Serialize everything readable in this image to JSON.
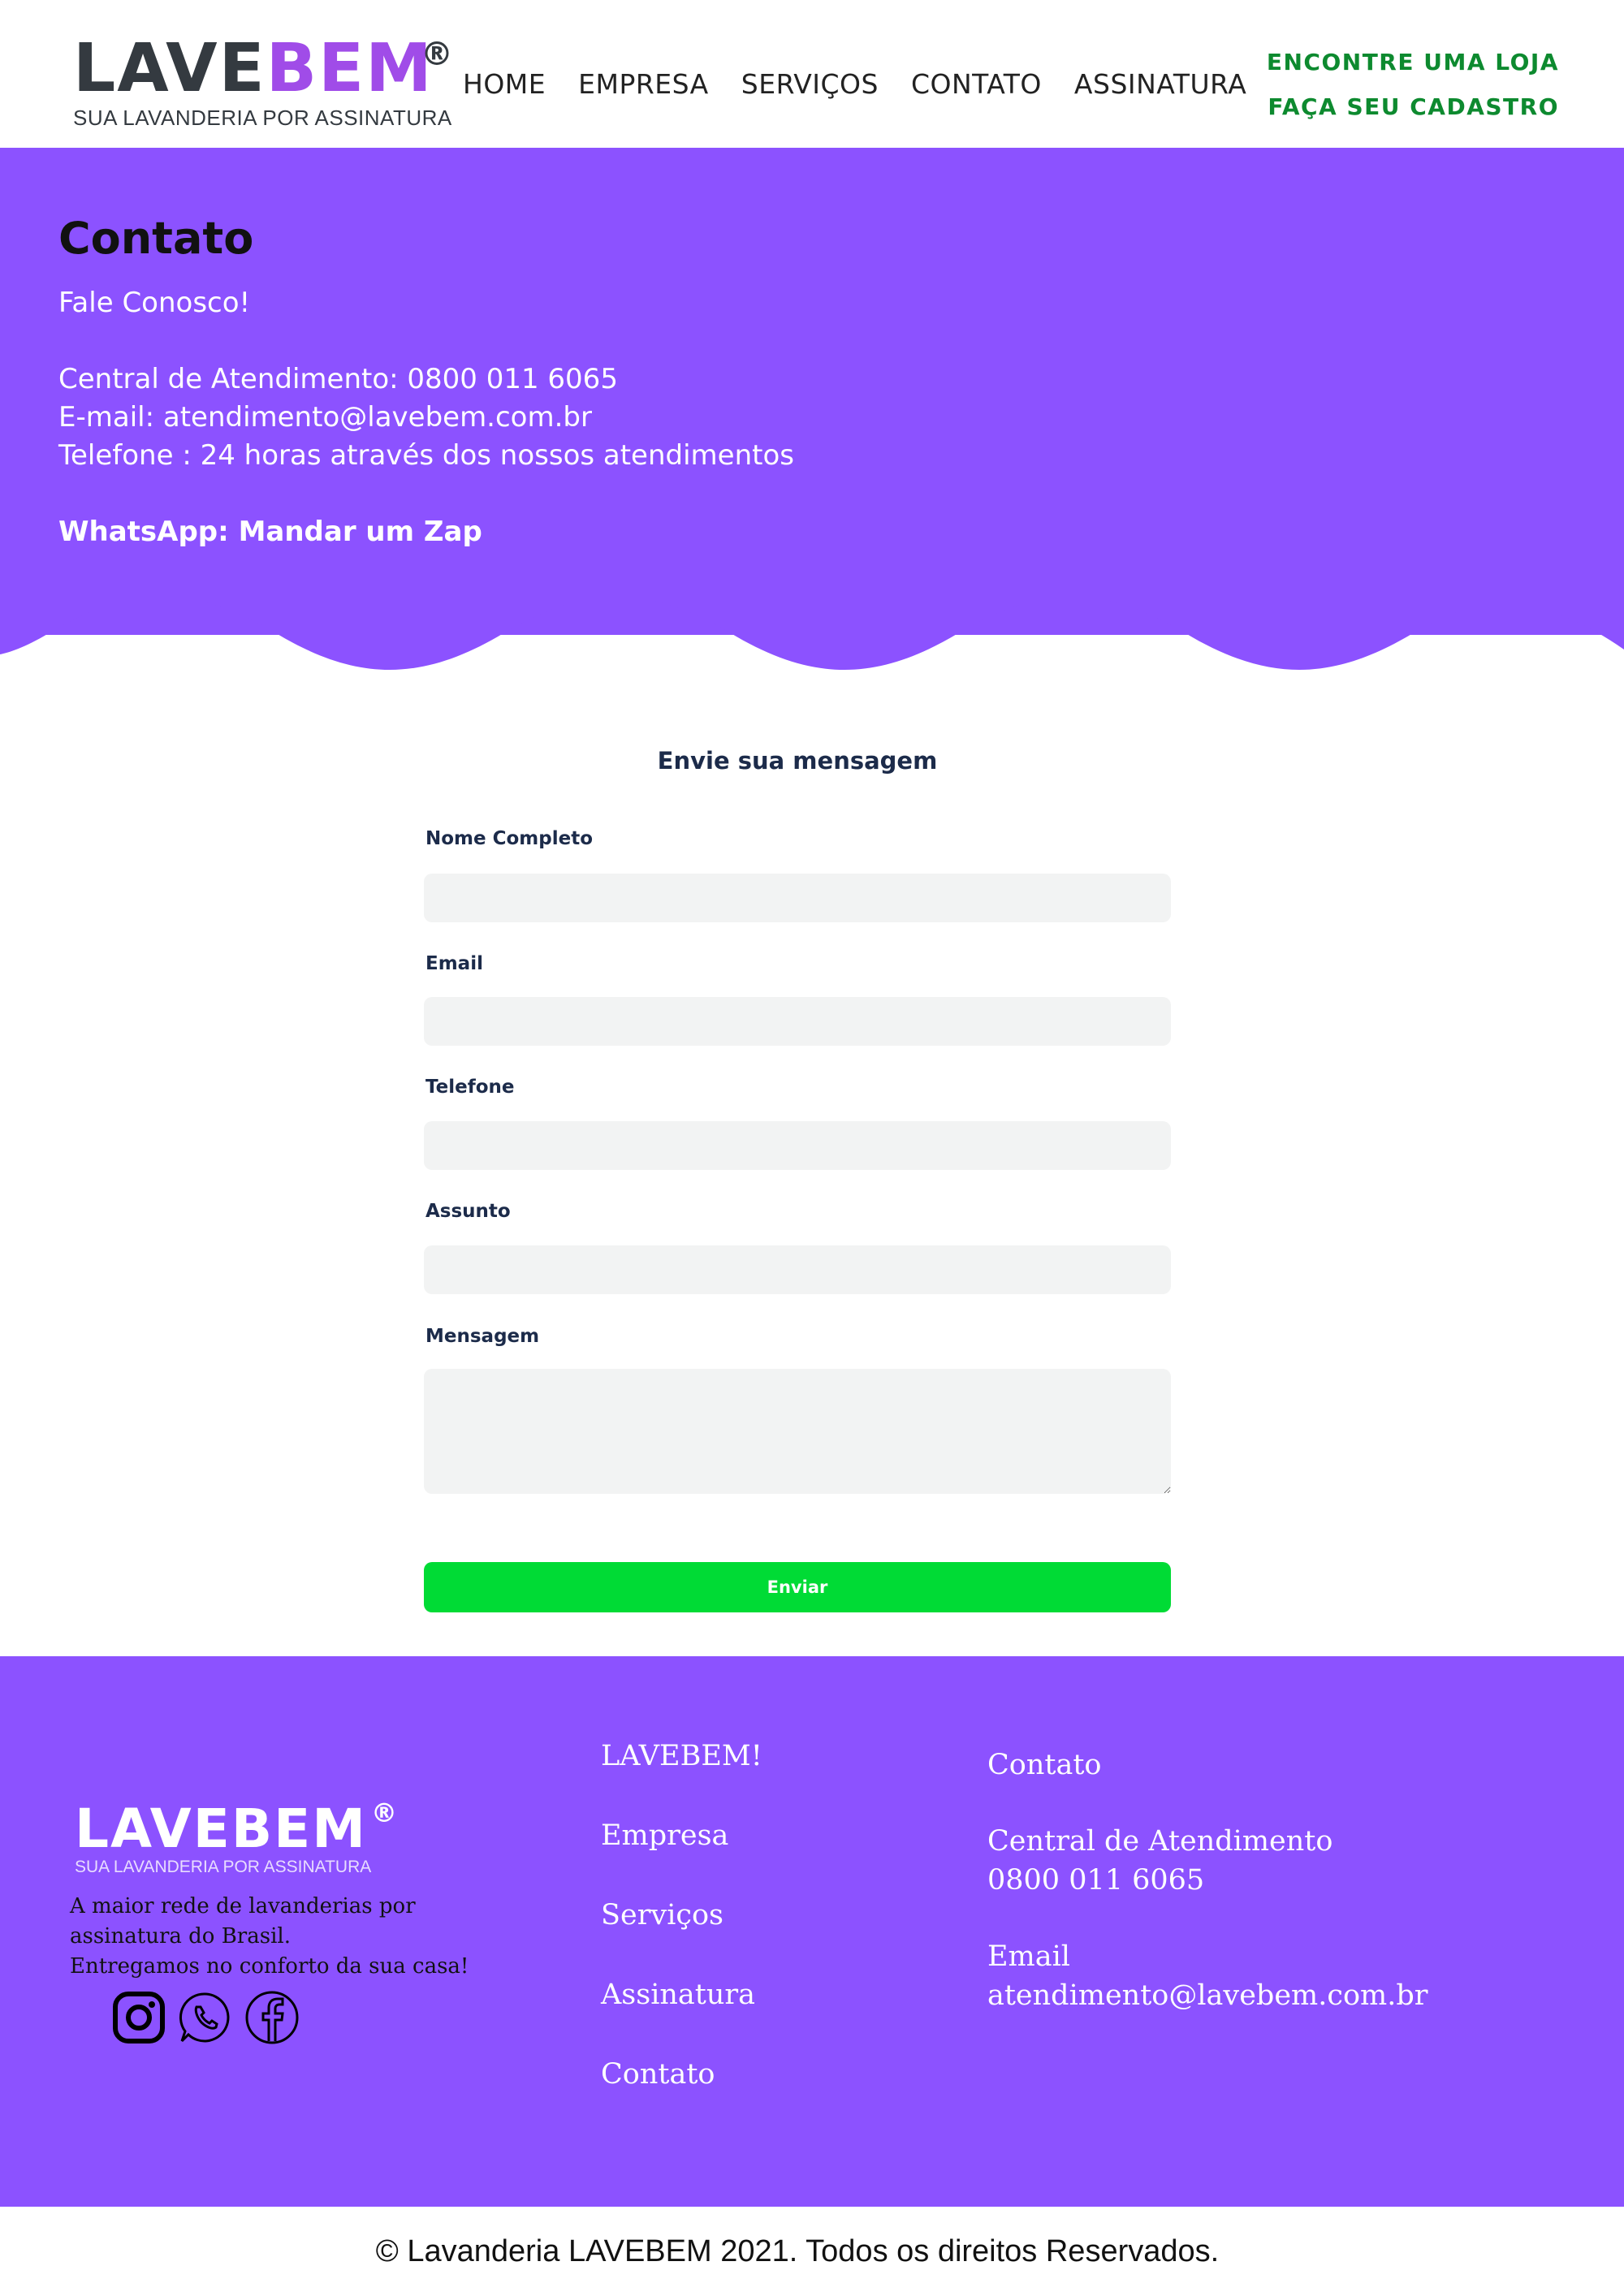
{
  "brand": {
    "logo_part1": "LAVE",
    "logo_part2": "BEM",
    "registered": "®",
    "tagline": "SUA LAVANDERIA POR ASSINATURA",
    "colors": {
      "purple": "#8c52ff",
      "green": "#0d8a2f",
      "button_green": "#00db35",
      "dark": "#343a40"
    }
  },
  "nav": {
    "items": [
      {
        "label": "HOME"
      },
      {
        "label": "EMPRESA"
      },
      {
        "label": "SERVIÇOS"
      },
      {
        "label": "CONTATO"
      },
      {
        "label": "ASSINATURA"
      }
    ],
    "cta_store": "ENCONTRE UMA LOJA",
    "cta_signup": "FAÇA SEU CADASTRO"
  },
  "hero": {
    "title": "Contato",
    "subtitle": "Fale Conosco!",
    "central": "Central de Atendimento: 0800 011 6065",
    "email": "E-mail: atendimento@lavebem.com.br",
    "phone": "Telefone : 24 horas através dos nossos atendimentos",
    "whatsapp": "WhatsApp: Mandar um Zap"
  },
  "form": {
    "title": "Envie sua mensagem",
    "name_label": "Nome Completo",
    "name_value": "",
    "email_label": "Email",
    "email_value": "",
    "phone_label": "Telefone",
    "phone_value": "",
    "subject_label": "Assunto",
    "subject_value": "",
    "message_label": "Mensagem",
    "message_value": "",
    "submit_label": "Enviar"
  },
  "footer": {
    "logo_text": "LAVEBEM",
    "registered": "®",
    "tagline": "SUA LAVANDERIA POR ASSINATURA",
    "desc_line1": "A maior rede de lavanderias por",
    "desc_line2": "assinatura do Brasil.",
    "desc_line3": "Entregamos no conforto da sua casa!",
    "social_icons": [
      "instagram-icon",
      "whatsapp-icon",
      "facebook-icon"
    ],
    "links": [
      {
        "label": "LAVEBEM!"
      },
      {
        "label": "Empresa"
      },
      {
        "label": "Serviços"
      },
      {
        "label": "Assinatura"
      },
      {
        "label": "Contato"
      }
    ],
    "contact_title": "Contato",
    "central_label": "Central de Atendimento",
    "central_number": "0800 011 6065",
    "email_label": "Email",
    "email_value": "atendimento@lavebem.com.br"
  },
  "copyright": "© Lavanderia LAVEBEM 2021. Todos os direitos Reservados."
}
